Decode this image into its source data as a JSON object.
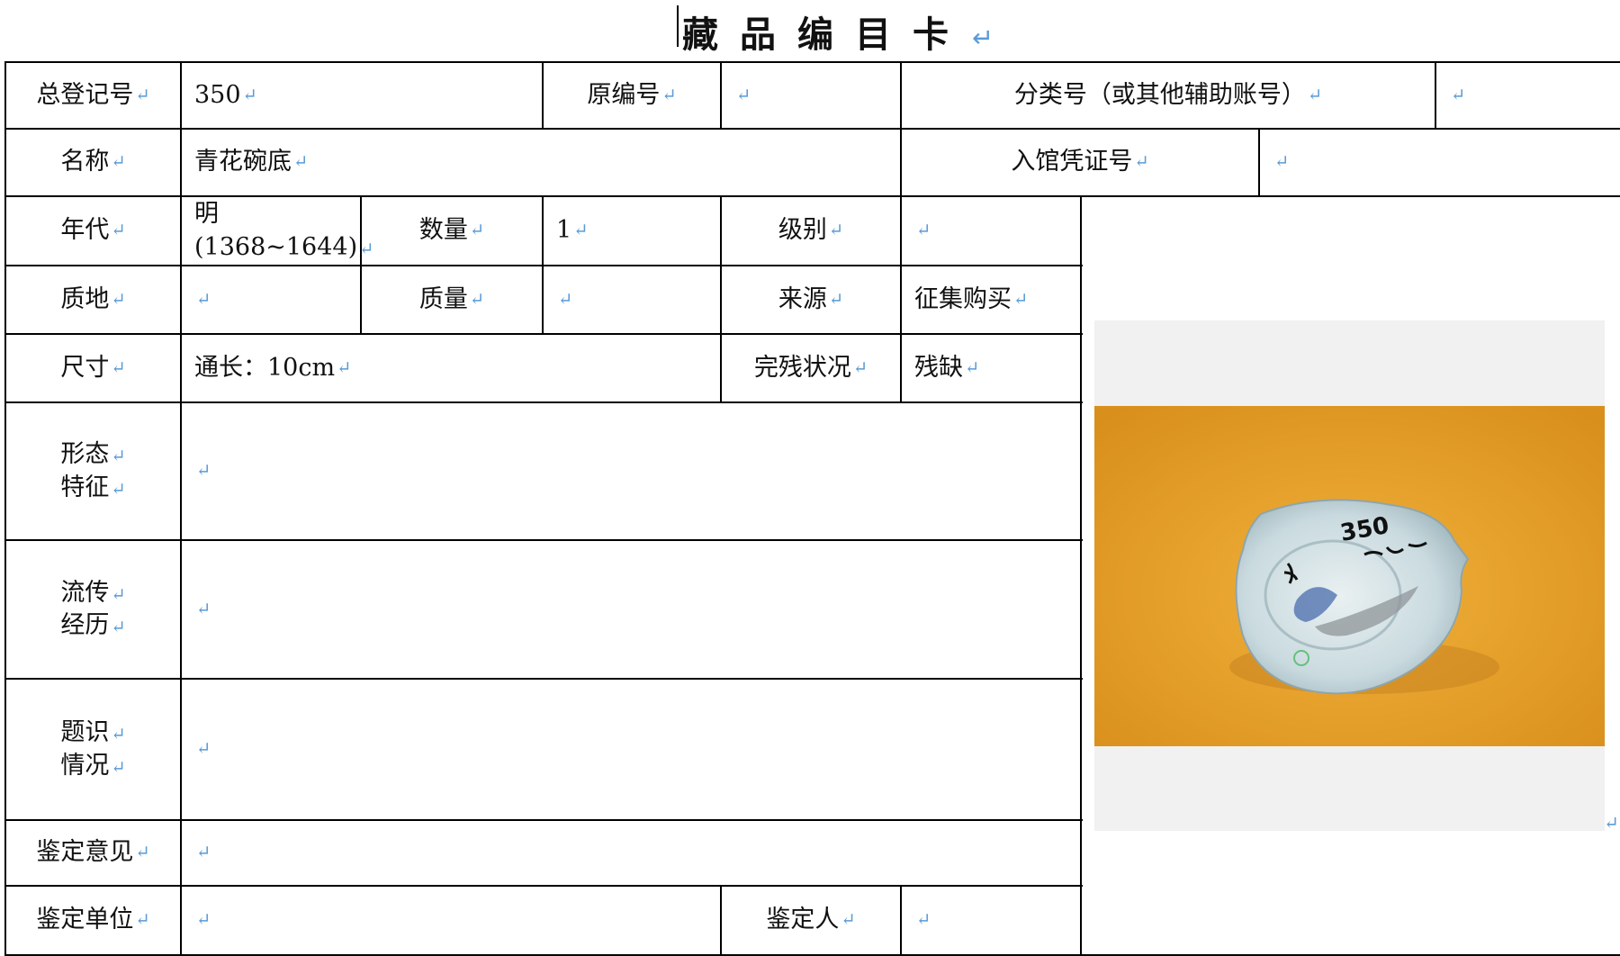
{
  "title": "藏品编目卡",
  "paragraph_mark": "↵",
  "colors": {
    "border": "#000000",
    "mark": "#5b9bd5",
    "photo_bg": "#e5a32b"
  },
  "card": {
    "reg_no_label": "总登记号",
    "reg_no_value": "350",
    "orig_no_label": "原编号",
    "orig_no_value": "",
    "class_no_label": "分类号（或其他辅助账号）",
    "class_no_value": "",
    "name_label": "名称",
    "name_value": "青花碗底",
    "voucher_label": "入馆凭证号",
    "voucher_value": "",
    "era_label": "年代",
    "era_value_line1": "明",
    "era_value_line2": "(1368~1644)",
    "quantity_label": "数量",
    "quantity_value": "1",
    "grade_label": "级别",
    "grade_value": "",
    "material_label": "质地",
    "material_value": "",
    "weight_label": "质量",
    "weight_value": "",
    "source_label": "来源",
    "source_value": "征集购买",
    "size_label": "尺寸",
    "size_value": "通长：10cm",
    "condition_label": "完残状况",
    "condition_value": "残缺",
    "form_label_1": "形态",
    "form_label_2": "特征",
    "form_value": "",
    "history_label_1": "流传",
    "history_label_2": "经历",
    "history_value": "",
    "inscription_label_1": "题识",
    "inscription_label_2": "情况",
    "inscription_value": "",
    "opinion_label": "鉴定意见",
    "opinion_value": "",
    "unit_label": "鉴定单位",
    "unit_value": "",
    "appraiser_label": "鉴定人",
    "appraiser_value": ""
  },
  "photo": {
    "icon": "porcelain-bowl-fragment-photo",
    "inscription_text": "350"
  }
}
